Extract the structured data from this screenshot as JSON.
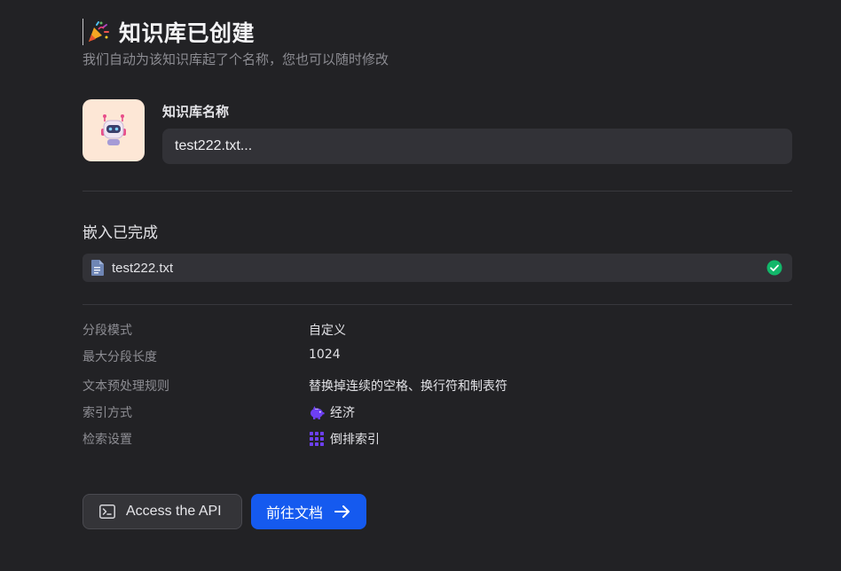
{
  "header": {
    "title": "知识库已创建",
    "subtitle": "我们自动为该知识库起了个名称，您也可以随时修改",
    "icon": "party-popper-icon"
  },
  "knowledge_base": {
    "name_label": "知识库名称",
    "name_value": "test222.txt...",
    "avatar_icon": "robot-icon",
    "avatar_bg": "#fde7d6"
  },
  "embedding": {
    "title": "嵌入已完成",
    "files": [
      {
        "name": "test222.txt",
        "status_icon": "check-circle-icon",
        "status_color": "#12b76a"
      }
    ]
  },
  "details": [
    {
      "label": "分段模式",
      "value": "自定义"
    },
    {
      "label": "最大分段长度",
      "value": "1024"
    },
    {
      "label": "文本预处理规则",
      "value": "替换掉连续的空格、换行符和制表符"
    },
    {
      "label": "索引方式",
      "value": "经济",
      "icon": "piggy-bank-icon"
    },
    {
      "label": "检索设置",
      "value": "倒排索引",
      "icon": "grid-icon"
    }
  ],
  "actions": {
    "api_label": "Access the API",
    "docs_label": "前往文档"
  },
  "colors": {
    "accent": "#155aef",
    "icon_purple": "#6d3ff3",
    "background": "#222225"
  }
}
